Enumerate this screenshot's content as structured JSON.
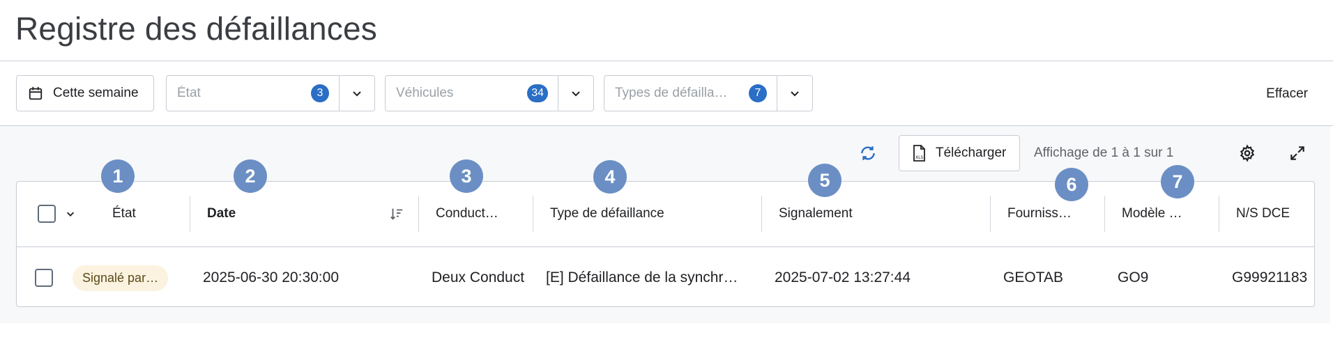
{
  "page": {
    "title": "Registre des défaillances"
  },
  "filters": {
    "week_label": "Cette semaine",
    "state": {
      "placeholder": "État",
      "count": "3"
    },
    "vehicles": {
      "placeholder": "Véhicules",
      "count": "34"
    },
    "fault_types": {
      "placeholder": "Types de défailla…",
      "count": "7"
    },
    "clear_label": "Effacer"
  },
  "toolbar": {
    "download_label": "Télécharger",
    "paging_text": "Affichage de 1 à 1 sur 1"
  },
  "table": {
    "columns": [
      "État",
      "Date",
      "Conduct…",
      "Type de défaillance",
      "Signalement",
      "Fourniss…",
      "Modèle …",
      "N/S DCE"
    ],
    "rows": [
      [
        "Signalé par…",
        "2025-06-30 20:30:00",
        "Deux Conduct",
        "[E] Défaillance de la synchr…",
        "2025-07-02 13:27:44",
        "GEOTAB",
        "GO9",
        "G99921183"
      ]
    ]
  },
  "markers": [
    "1",
    "2",
    "3",
    "4",
    "5",
    "6",
    "7"
  ],
  "colors": {
    "accent": "#2a6ec5",
    "marker": "#6b8fc4",
    "pill_bg": "#fbf3e0"
  }
}
